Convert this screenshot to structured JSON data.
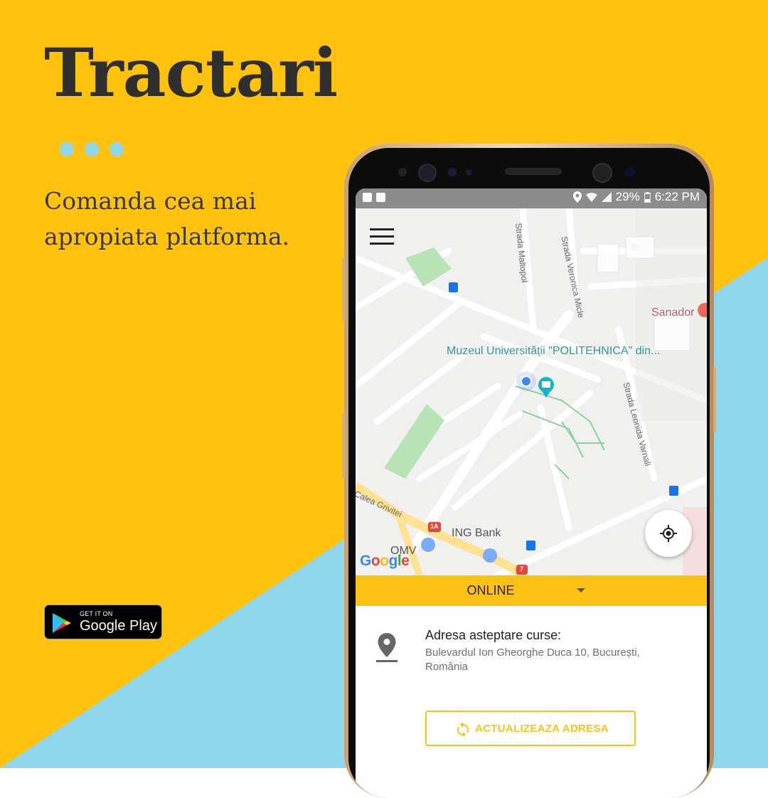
{
  "brand": {
    "title": "Tractari",
    "tagline": "Comanda cea mai apropiata platforma.",
    "colors": {
      "background_yellow": "#FFC20E",
      "background_blue": "#8FD6EA",
      "text_dark": "#2F2F2F"
    }
  },
  "store_badge": {
    "small_text": "GET IT ON",
    "big_text": "Google Play",
    "icon": "google-play-icon"
  },
  "status_bar": {
    "battery": "29%",
    "time": "6:22 PM",
    "icons": [
      "location-icon",
      "wifi-icon",
      "signal-icon",
      "battery-icon"
    ]
  },
  "map": {
    "menu_icon": "hamburger-menu-icon",
    "labels": {
      "museum": "Muzeul Universității \"POLITEHNICA\" din...",
      "sanador": "Sanador",
      "ing": "ING Bank",
      "omv": "OMV"
    },
    "streets": [
      "Strada Maltopol",
      "Strada Veronica Micle",
      "Strada Leonida Varnali",
      "Calea Grivitei"
    ],
    "road_badges": [
      "1A",
      "7"
    ],
    "attribution": "Google",
    "locate_icon": "my-location-icon"
  },
  "status_selector": {
    "value": "ONLINE",
    "color": "#FBC114"
  },
  "address_card": {
    "title": "Adresa asteptare curse:",
    "value": "Bulevardul Ion Gheorghe Duca 10, București, România",
    "button_label": "ACTUALIZEAZA ADRESA",
    "button_icon": "refresh-icon"
  }
}
